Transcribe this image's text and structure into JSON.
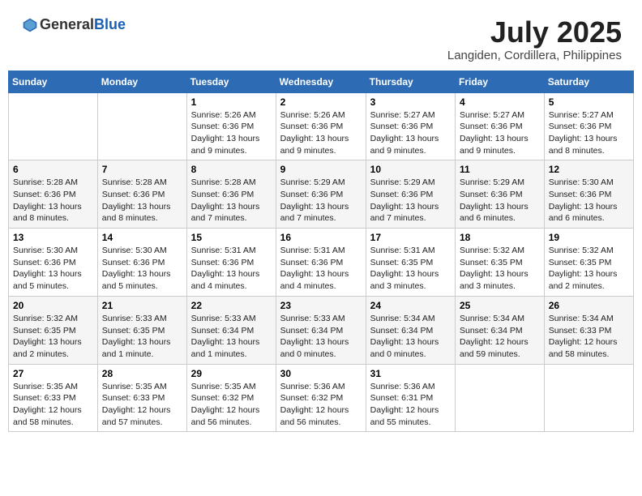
{
  "header": {
    "logo_general": "General",
    "logo_blue": "Blue",
    "month_year": "July 2025",
    "location": "Langiden, Cordillera, Philippines"
  },
  "weekdays": [
    "Sunday",
    "Monday",
    "Tuesday",
    "Wednesday",
    "Thursday",
    "Friday",
    "Saturday"
  ],
  "weeks": [
    [
      {
        "day": "",
        "info": ""
      },
      {
        "day": "",
        "info": ""
      },
      {
        "day": "1",
        "info": "Sunrise: 5:26 AM\nSunset: 6:36 PM\nDaylight: 13 hours and 9 minutes."
      },
      {
        "day": "2",
        "info": "Sunrise: 5:26 AM\nSunset: 6:36 PM\nDaylight: 13 hours and 9 minutes."
      },
      {
        "day": "3",
        "info": "Sunrise: 5:27 AM\nSunset: 6:36 PM\nDaylight: 13 hours and 9 minutes."
      },
      {
        "day": "4",
        "info": "Sunrise: 5:27 AM\nSunset: 6:36 PM\nDaylight: 13 hours and 9 minutes."
      },
      {
        "day": "5",
        "info": "Sunrise: 5:27 AM\nSunset: 6:36 PM\nDaylight: 13 hours and 8 minutes."
      }
    ],
    [
      {
        "day": "6",
        "info": "Sunrise: 5:28 AM\nSunset: 6:36 PM\nDaylight: 13 hours and 8 minutes."
      },
      {
        "day": "7",
        "info": "Sunrise: 5:28 AM\nSunset: 6:36 PM\nDaylight: 13 hours and 8 minutes."
      },
      {
        "day": "8",
        "info": "Sunrise: 5:28 AM\nSunset: 6:36 PM\nDaylight: 13 hours and 7 minutes."
      },
      {
        "day": "9",
        "info": "Sunrise: 5:29 AM\nSunset: 6:36 PM\nDaylight: 13 hours and 7 minutes."
      },
      {
        "day": "10",
        "info": "Sunrise: 5:29 AM\nSunset: 6:36 PM\nDaylight: 13 hours and 7 minutes."
      },
      {
        "day": "11",
        "info": "Sunrise: 5:29 AM\nSunset: 6:36 PM\nDaylight: 13 hours and 6 minutes."
      },
      {
        "day": "12",
        "info": "Sunrise: 5:30 AM\nSunset: 6:36 PM\nDaylight: 13 hours and 6 minutes."
      }
    ],
    [
      {
        "day": "13",
        "info": "Sunrise: 5:30 AM\nSunset: 6:36 PM\nDaylight: 13 hours and 5 minutes."
      },
      {
        "day": "14",
        "info": "Sunrise: 5:30 AM\nSunset: 6:36 PM\nDaylight: 13 hours and 5 minutes."
      },
      {
        "day": "15",
        "info": "Sunrise: 5:31 AM\nSunset: 6:36 PM\nDaylight: 13 hours and 4 minutes."
      },
      {
        "day": "16",
        "info": "Sunrise: 5:31 AM\nSunset: 6:36 PM\nDaylight: 13 hours and 4 minutes."
      },
      {
        "day": "17",
        "info": "Sunrise: 5:31 AM\nSunset: 6:35 PM\nDaylight: 13 hours and 3 minutes."
      },
      {
        "day": "18",
        "info": "Sunrise: 5:32 AM\nSunset: 6:35 PM\nDaylight: 13 hours and 3 minutes."
      },
      {
        "day": "19",
        "info": "Sunrise: 5:32 AM\nSunset: 6:35 PM\nDaylight: 13 hours and 2 minutes."
      }
    ],
    [
      {
        "day": "20",
        "info": "Sunrise: 5:32 AM\nSunset: 6:35 PM\nDaylight: 13 hours and 2 minutes."
      },
      {
        "day": "21",
        "info": "Sunrise: 5:33 AM\nSunset: 6:35 PM\nDaylight: 13 hours and 1 minute."
      },
      {
        "day": "22",
        "info": "Sunrise: 5:33 AM\nSunset: 6:34 PM\nDaylight: 13 hours and 1 minutes."
      },
      {
        "day": "23",
        "info": "Sunrise: 5:33 AM\nSunset: 6:34 PM\nDaylight: 13 hours and 0 minutes."
      },
      {
        "day": "24",
        "info": "Sunrise: 5:34 AM\nSunset: 6:34 PM\nDaylight: 13 hours and 0 minutes."
      },
      {
        "day": "25",
        "info": "Sunrise: 5:34 AM\nSunset: 6:34 PM\nDaylight: 12 hours and 59 minutes."
      },
      {
        "day": "26",
        "info": "Sunrise: 5:34 AM\nSunset: 6:33 PM\nDaylight: 12 hours and 58 minutes."
      }
    ],
    [
      {
        "day": "27",
        "info": "Sunrise: 5:35 AM\nSunset: 6:33 PM\nDaylight: 12 hours and 58 minutes."
      },
      {
        "day": "28",
        "info": "Sunrise: 5:35 AM\nSunset: 6:33 PM\nDaylight: 12 hours and 57 minutes."
      },
      {
        "day": "29",
        "info": "Sunrise: 5:35 AM\nSunset: 6:32 PM\nDaylight: 12 hours and 56 minutes."
      },
      {
        "day": "30",
        "info": "Sunrise: 5:36 AM\nSunset: 6:32 PM\nDaylight: 12 hours and 56 minutes."
      },
      {
        "day": "31",
        "info": "Sunrise: 5:36 AM\nSunset: 6:31 PM\nDaylight: 12 hours and 55 minutes."
      },
      {
        "day": "",
        "info": ""
      },
      {
        "day": "",
        "info": ""
      }
    ]
  ]
}
